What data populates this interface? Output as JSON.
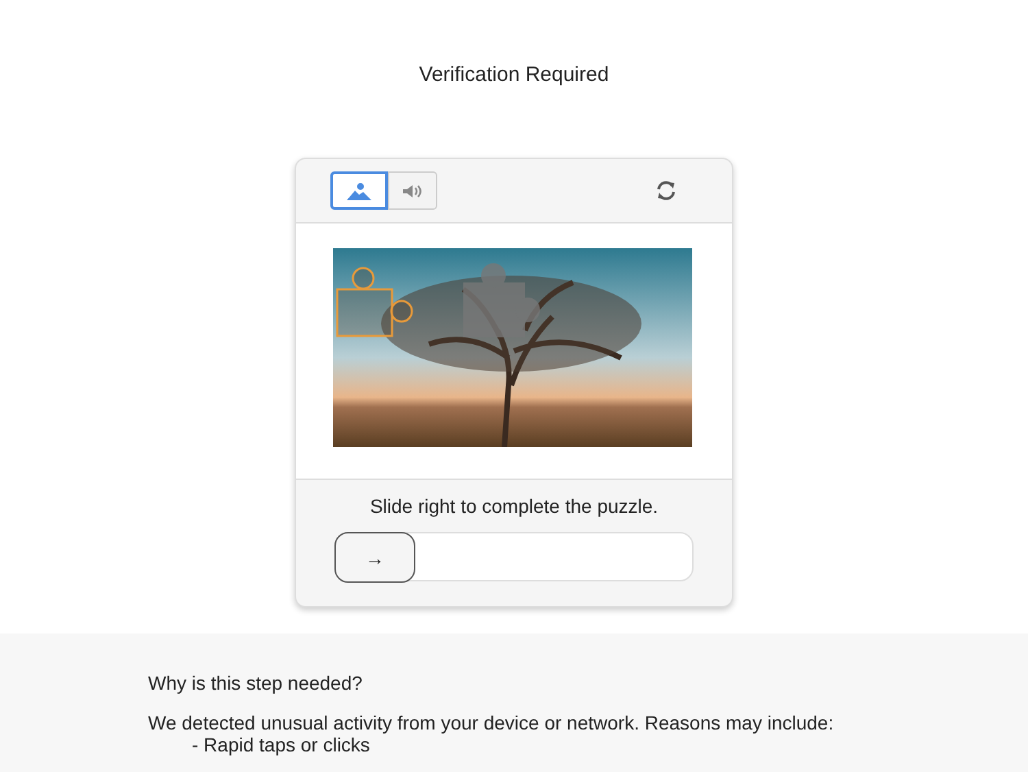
{
  "title": "Verification Required",
  "challenge": {
    "modes": [
      {
        "kind": "image",
        "selected": true
      },
      {
        "kind": "audio",
        "selected": false
      }
    ],
    "instruction": "Slide right to complete the puzzle.",
    "slider": {
      "level": 0,
      "handle": "→"
    }
  },
  "info": {
    "heading": "Why is this step needed?",
    "text": "We detected unusual activity from your device or network. Reasons may include:",
    "reasons": [
      "- Rapid taps or clicks"
    ]
  }
}
